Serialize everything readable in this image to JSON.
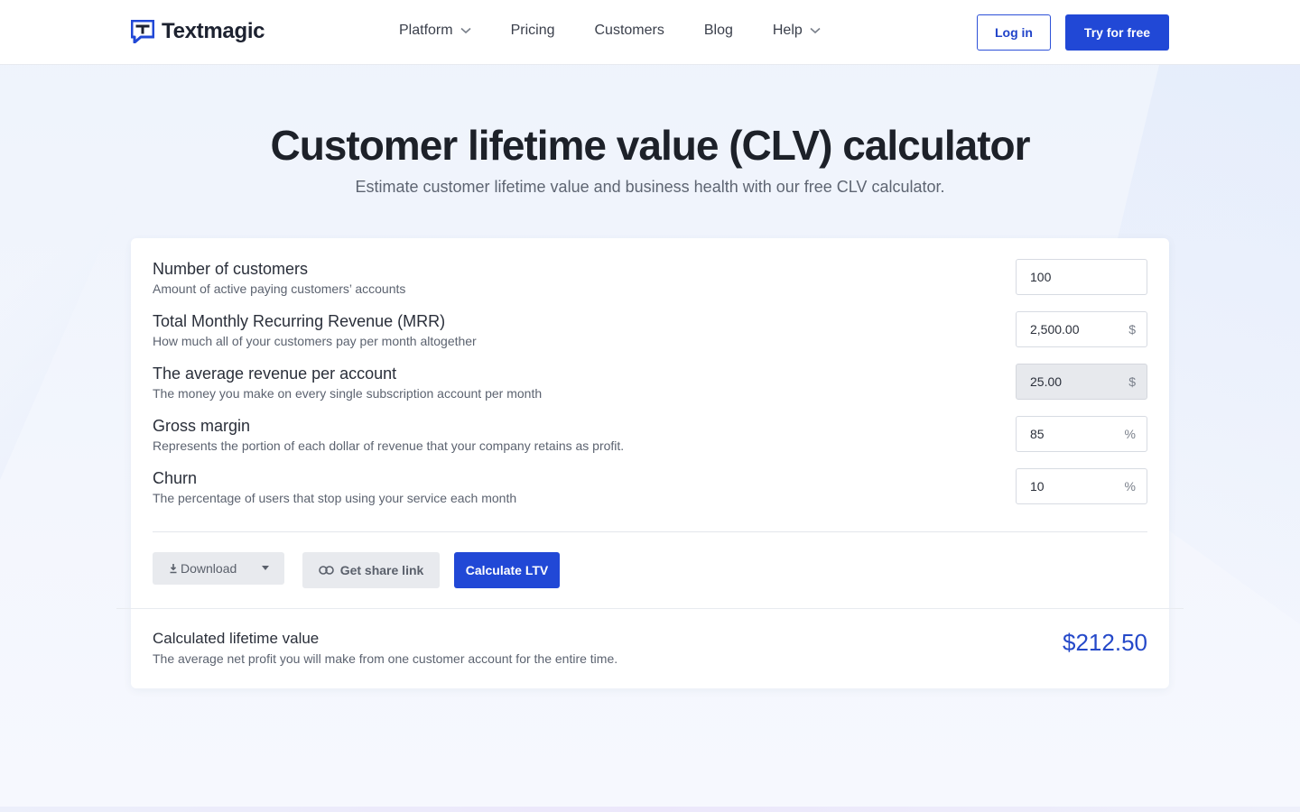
{
  "header": {
    "logo_text": "Textmagic",
    "nav": [
      {
        "label": "Platform",
        "dropdown": true
      },
      {
        "label": "Pricing",
        "dropdown": false
      },
      {
        "label": "Customers",
        "dropdown": false
      },
      {
        "label": "Blog",
        "dropdown": false
      },
      {
        "label": "Help",
        "dropdown": true
      }
    ],
    "login_label": "Log in",
    "try_label": "Try for free"
  },
  "hero": {
    "title": "Customer lifetime value (CLV) calculator",
    "subtitle": "Estimate customer lifetime value and business health with our free CLV calculator."
  },
  "calculator": {
    "rows": [
      {
        "label": "Number of customers",
        "desc": "Amount of active paying customers’ accounts",
        "value": "100",
        "suffix": "",
        "readonly": false
      },
      {
        "label": "Total Monthly Recurring Revenue (MRR)",
        "desc": "How much all of your customers pay per month altogether",
        "value": "2,500.00",
        "suffix": "$",
        "readonly": false
      },
      {
        "label": "The average revenue per account",
        "desc": "The money you make on every single subscription account per month",
        "value": "25.00",
        "suffix": "$",
        "readonly": true
      },
      {
        "label": "Gross margin",
        "desc": "Represents the portion of each dollar of revenue that your company retains as profit.",
        "value": "85",
        "suffix": "%",
        "readonly": false
      },
      {
        "label": "Churn",
        "desc": "The percentage of users that stop using your service each month",
        "value": "10",
        "suffix": "%",
        "readonly": false
      }
    ],
    "download_label": "Download",
    "share_label": "Get share link",
    "calculate_label": "Calculate LTV"
  },
  "result": {
    "label": "Calculated lifetime value",
    "desc": "The average net profit you will make from one customer account for the entire time.",
    "value": "$212.50"
  },
  "colors": {
    "brand_blue": "#2148d6",
    "result_blue": "#2549c9"
  }
}
